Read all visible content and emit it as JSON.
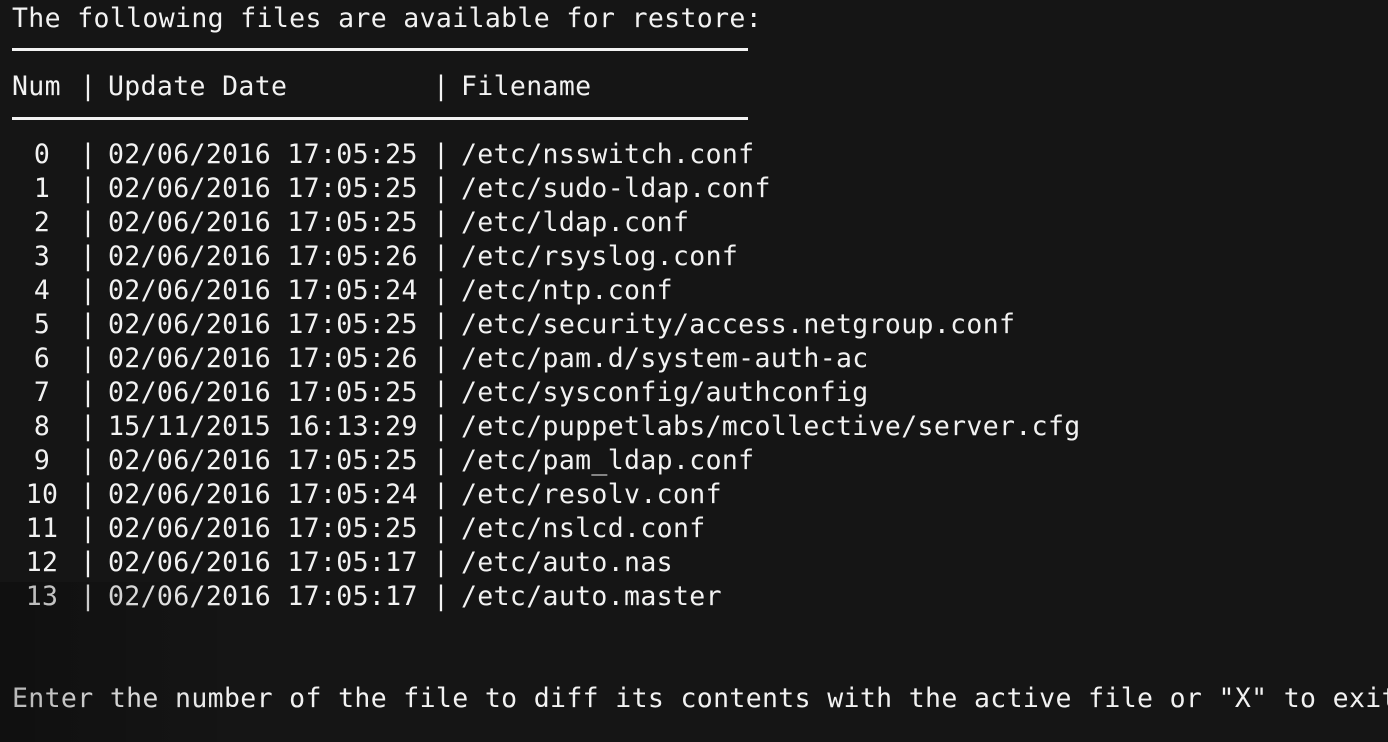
{
  "terminal": {
    "title_line": "The following files are available for restore:",
    "headers": {
      "num": "Num",
      "sep": "|",
      "date": "Update Date",
      "file": "Filename"
    },
    "rows": [
      {
        "num": "0",
        "date": "02/06/2016 17:05:25",
        "file": "/etc/nsswitch.conf"
      },
      {
        "num": "1",
        "date": "02/06/2016 17:05:25",
        "file": "/etc/sudo-ldap.conf"
      },
      {
        "num": "2",
        "date": "02/06/2016 17:05:25",
        "file": "/etc/ldap.conf"
      },
      {
        "num": "3",
        "date": "02/06/2016 17:05:26",
        "file": "/etc/rsyslog.conf"
      },
      {
        "num": "4",
        "date": "02/06/2016 17:05:24",
        "file": "/etc/ntp.conf"
      },
      {
        "num": "5",
        "date": "02/06/2016 17:05:25",
        "file": "/etc/security/access.netgroup.conf"
      },
      {
        "num": "6",
        "date": "02/06/2016 17:05:26",
        "file": "/etc/pam.d/system-auth-ac"
      },
      {
        "num": "7",
        "date": "02/06/2016 17:05:25",
        "file": "/etc/sysconfig/authconfig"
      },
      {
        "num": "8",
        "date": "15/11/2015 16:13:29",
        "file": "/etc/puppetlabs/mcollective/server.cfg"
      },
      {
        "num": "9",
        "date": "02/06/2016 17:05:25",
        "file": "/etc/pam_ldap.conf"
      },
      {
        "num": "10",
        "date": "02/06/2016 17:05:24",
        "file": "/etc/resolv.conf"
      },
      {
        "num": "11",
        "date": "02/06/2016 17:05:25",
        "file": "/etc/nslcd.conf"
      },
      {
        "num": "12",
        "date": "02/06/2016 17:05:17",
        "file": "/etc/auto.nas"
      },
      {
        "num": "13",
        "date": "02/06/2016 17:05:17",
        "file": "/etc/auto.master"
      }
    ],
    "prompt": "Enter the number of the file to diff its contents with the active file or \"X\" to exit",
    "colors": {
      "background": "#151515",
      "foreground": "#f2f2f2"
    }
  }
}
